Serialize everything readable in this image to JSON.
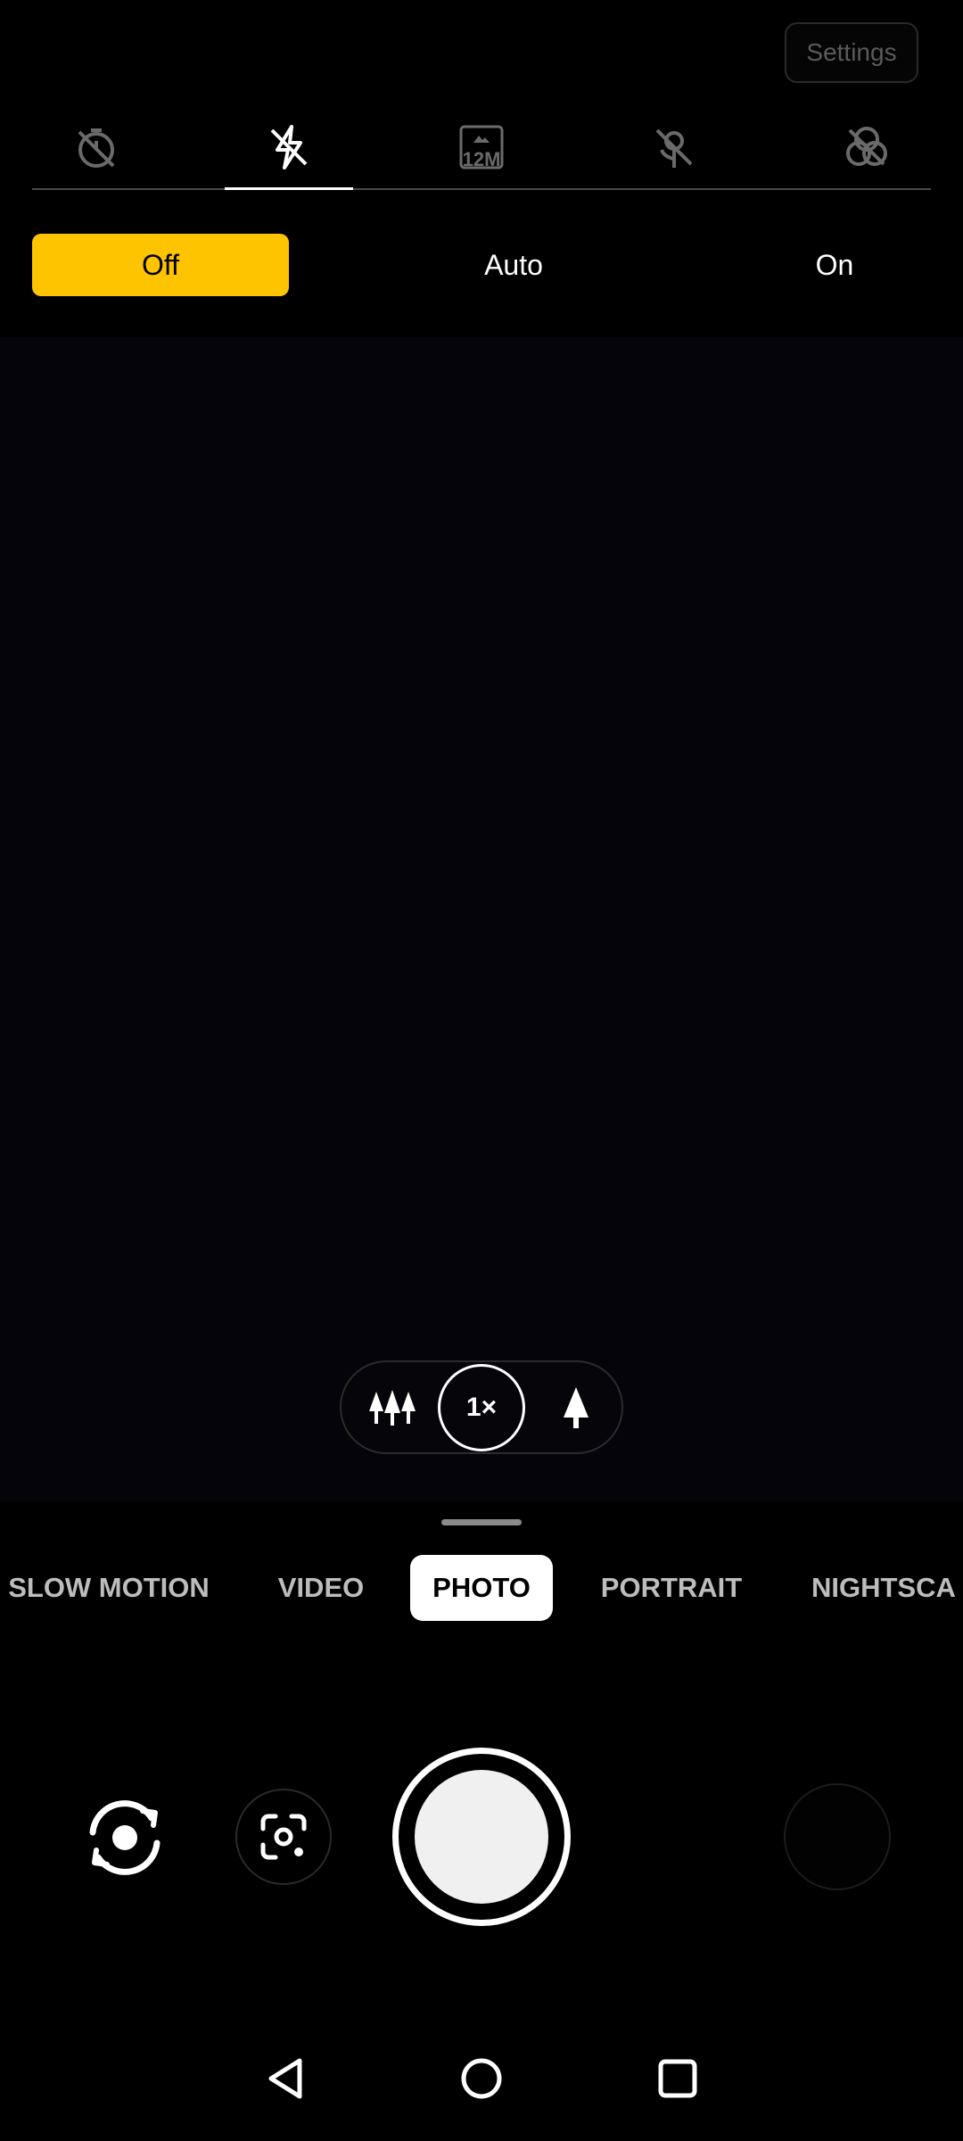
{
  "top": {
    "settings_label": "Settings"
  },
  "quick_settings": {
    "tabs": [
      {
        "icon": "timer-off-icon",
        "active": false
      },
      {
        "icon": "flash-off-icon",
        "active": true
      },
      {
        "icon": "resolution-12m-icon",
        "label": "12M",
        "active": false
      },
      {
        "icon": "macro-off-icon",
        "active": false
      },
      {
        "icon": "filter-off-icon",
        "active": false
      }
    ]
  },
  "flash_options": {
    "options": [
      "Off",
      "Auto",
      "On"
    ],
    "selected": "Off",
    "accent_color": "#ffc400"
  },
  "zoom": {
    "wide_icon": "trees-wide-icon",
    "current": "1×",
    "tele_icon": "tree-tele-icon"
  },
  "modes": {
    "items": [
      "SLOW MOTION",
      "VIDEO",
      "PHOTO",
      "PORTRAIT",
      "NIGHTSCA"
    ],
    "selected": "PHOTO"
  },
  "controls": {
    "switch_camera_icon": "camera-switch-icon",
    "lens_icon": "google-lens-icon",
    "shutter": "shutter-button",
    "gallery": "gallery-thumbnail"
  },
  "navigation": [
    "back-icon",
    "home-icon",
    "recents-icon"
  ]
}
